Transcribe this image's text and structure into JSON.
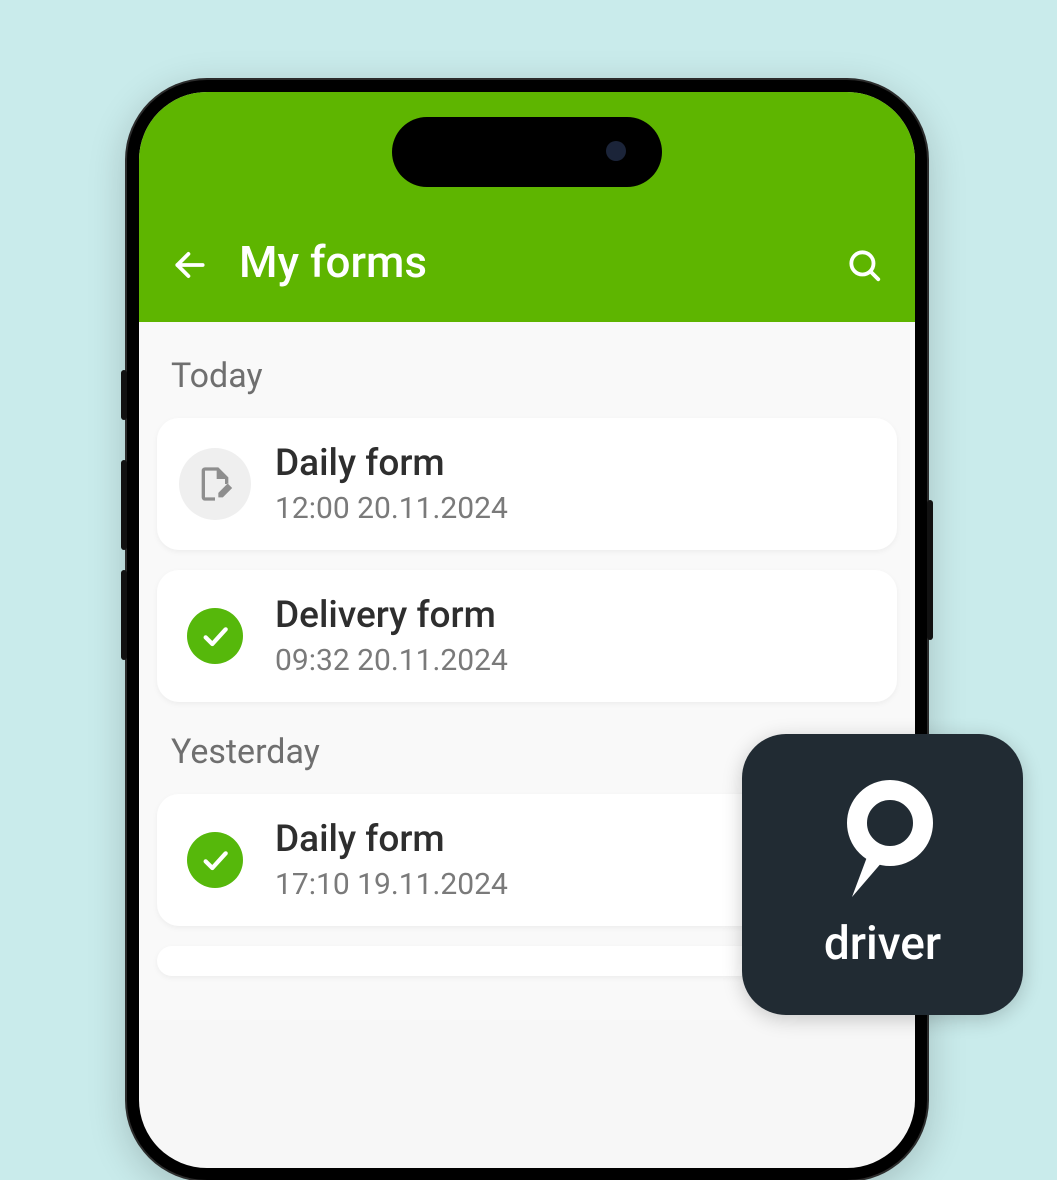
{
  "header": {
    "title": "My forms"
  },
  "sections": [
    {
      "label": "Today",
      "items": [
        {
          "title": "Daily form",
          "sub": "12:00 20.11.2024",
          "status": "pending"
        },
        {
          "title": "Delivery form",
          "sub": "09:32 20.11.2024",
          "status": "done"
        }
      ]
    },
    {
      "label": "Yesterday",
      "items": [
        {
          "title": "Daily form",
          "sub": "17:10 19.11.2024",
          "status": "done"
        }
      ]
    }
  ],
  "badge": {
    "label": "driver"
  }
}
